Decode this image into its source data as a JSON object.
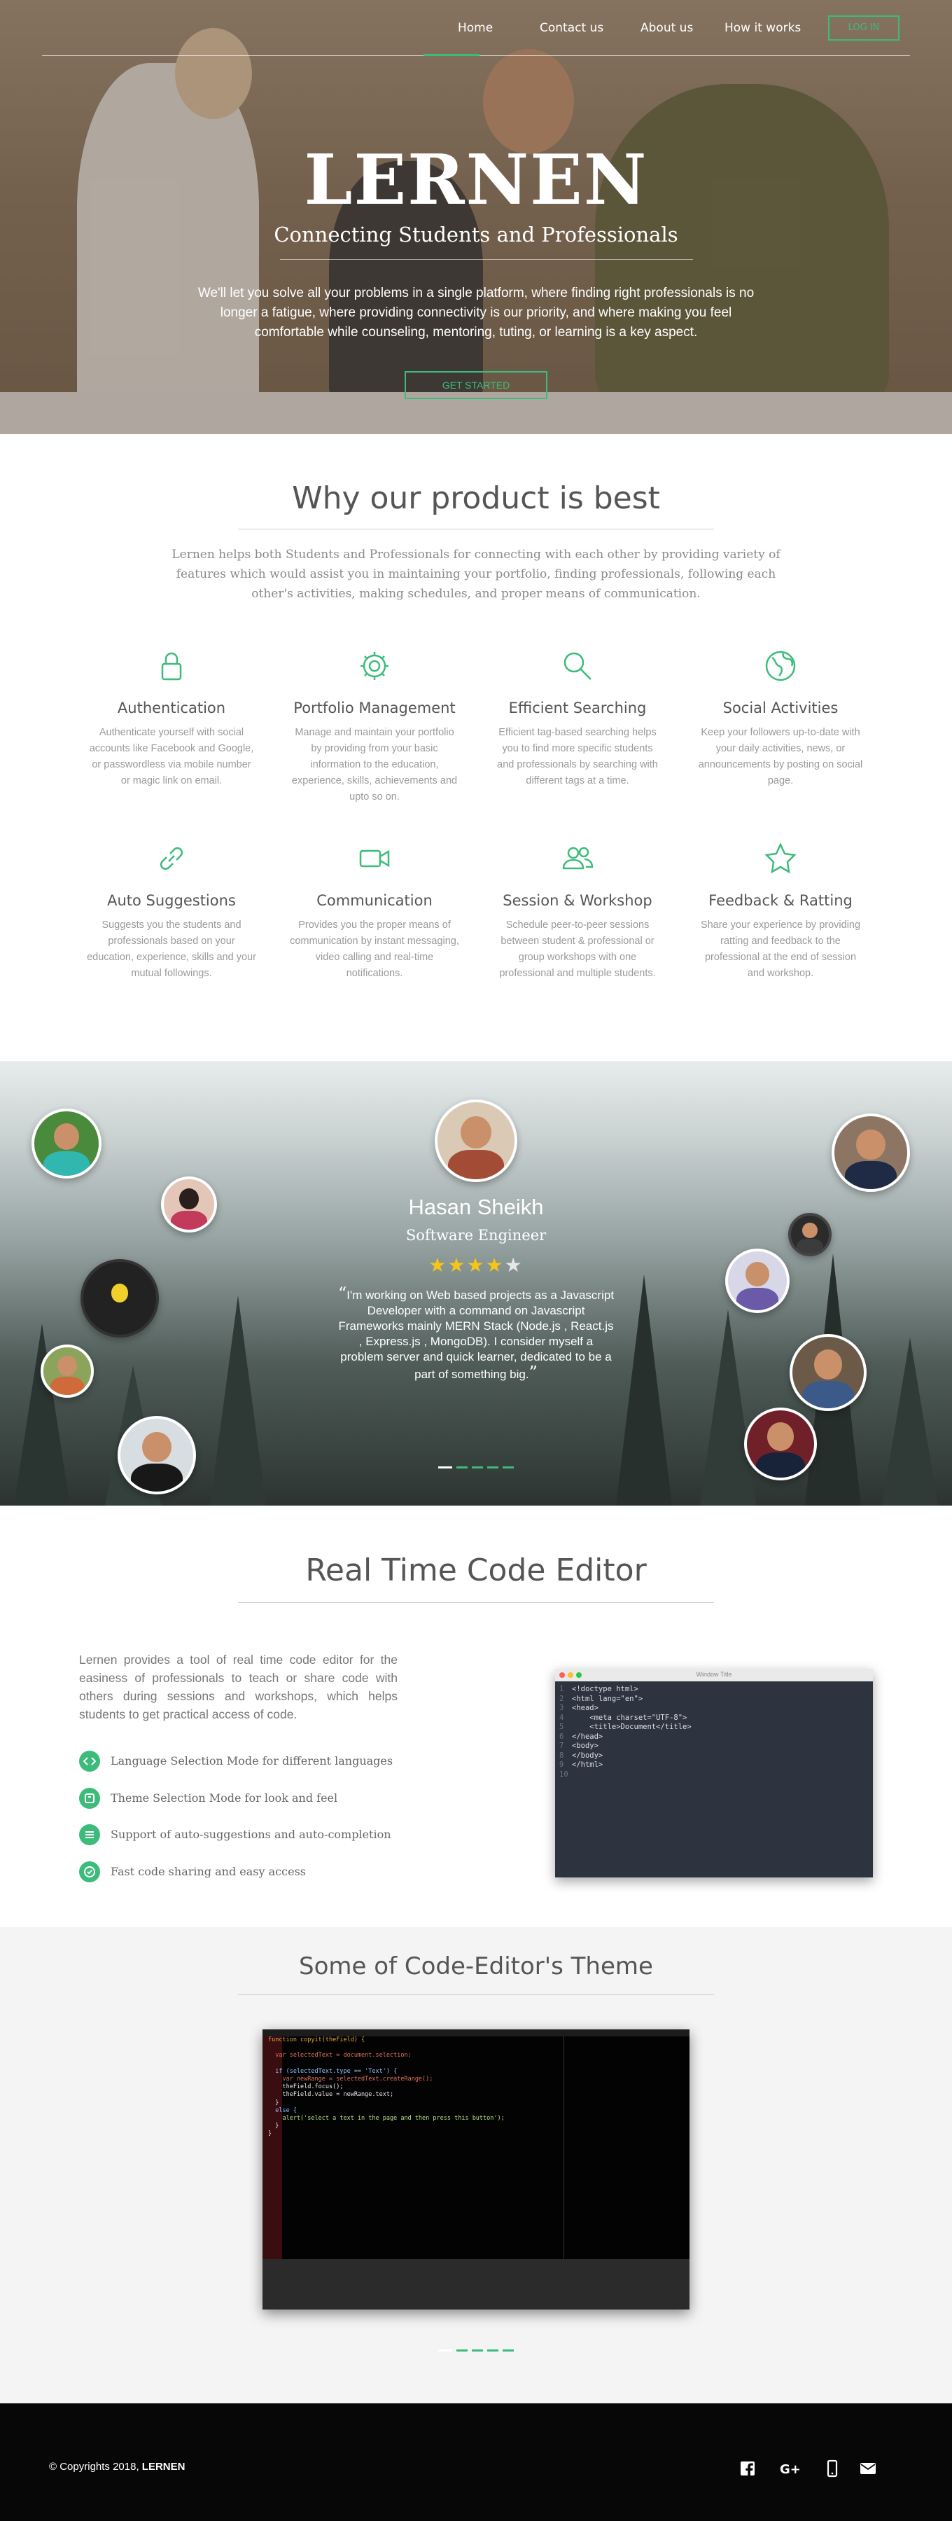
{
  "nav": {
    "items": [
      "Home",
      "Contact us",
      "About us",
      "How it works"
    ],
    "login": "LOG IN"
  },
  "hero": {
    "title": "LERNEN",
    "subtitle": "Connecting Students and Professionals",
    "description": "We'll let you solve all your problems in a single platform, where finding right professionals is no longer a fatigue, where providing connectivity is our priority, and where making you feel comfortable while counseling, mentoring, tuting, or learning is a key aspect.",
    "cta": "GET STARTED"
  },
  "features": {
    "title": "Why our product is best",
    "description": "Lernen helps both Students and Professionals for connecting with each other by providing variety of features which would assist you in maintaining your portfolio, finding professionals, following each other's activities, making schedules, and proper means of communication.",
    "items": [
      {
        "icon": "lock-icon",
        "title": "Authentication",
        "text": "Authenticate yourself with social accounts like Facebook and Google, or passwordless via mobile number or magic link on email."
      },
      {
        "icon": "gear-icon",
        "title": "Portfolio Management",
        "text": "Manage and maintain your portfolio by providing from your basic information to the education, experience, skills, achievements and upto so on."
      },
      {
        "icon": "search-icon",
        "title": "Efficient Searching",
        "text": "Efficient tag-based searching helps you to find more specific students and professionals by searching with different tags at a time."
      },
      {
        "icon": "globe-icon",
        "title": "Social Activities",
        "text": "Keep your followers up-to-date with your daily activities, news, or announcements by posting on social page."
      },
      {
        "icon": "link-icon",
        "title": "Auto Suggestions",
        "text": "Suggests you the students and professionals based on your education, experience, skills and your mutual followings."
      },
      {
        "icon": "video-icon",
        "title": "Communication",
        "text": "Provides you the proper means of communication by instant messaging, video calling and real-time notifications."
      },
      {
        "icon": "users-icon",
        "title": "Session & Workshop",
        "text": "Schedule peer-to-peer sessions between student & professional or group workshops with one professional and multiple students."
      },
      {
        "icon": "star-icon",
        "title": "Feedback & Ratting",
        "text": "Share your experience by providing ratting and feedback to the professional at the end of session and workshop."
      }
    ]
  },
  "testimonial": {
    "name": "Hasan Sheikh",
    "role": "Software Engineer",
    "rating": 4,
    "quote_open": "“",
    "quote": "I'm working on Web based projects as a Javascript Developer with a command on Javascript Frameworks mainly MERN Stack (Node.js , React.js , Express.js , MongoDB). I consider myself a problem server and quick learner, dedicated to be a part of something big.",
    "quote_close": "”"
  },
  "editor": {
    "title": "Real Time Code Editor",
    "intro": "Lernen provides a tool of real time code editor for the easiness of professionals to teach or share code with others during sessions and workshops, which helps students to get practical access of code.",
    "bullets": [
      {
        "icon": "code-icon",
        "text": "Language Selection Mode for different languages"
      },
      {
        "icon": "palette-icon",
        "text": "Theme Selection Mode for look and feel"
      },
      {
        "icon": "list-icon",
        "text": "Support of auto-suggestions and auto-completion"
      },
      {
        "icon": "check-icon",
        "text": "Fast code sharing and easy access"
      }
    ],
    "window_title": "Window Title",
    "code_lines": [
      "<!doctype html>",
      "<html lang=\"en\">",
      "<head>",
      "    <meta charset=\"UTF-8\">",
      "    <title>Document</title>",
      "</head>",
      "<body>",
      "</body>",
      "</html>",
      ""
    ]
  },
  "themes": {
    "title": "Some of Code-Editor's Theme",
    "code_lines": [
      "function copyit(theField) {",
      "",
      "  var selectedText = document.selection;",
      "",
      "  if (selectedText.type == 'Text') {",
      "    var newRange = selectedText.createRange();",
      "    theField.focus();",
      "    theField.value = newRange.text;",
      "  }",
      "  else {",
      "    alert('select a text in the page and then press this button');",
      "  }",
      "}",
      ""
    ]
  },
  "footer": {
    "copyright": "© Copyrights 2018,",
    "brand": "LERNEN",
    "social": [
      "facebook-icon",
      "google-plus-icon",
      "phone-icon",
      "email-icon"
    ]
  },
  "colors": {
    "accent": "#3dbb7b",
    "star": "#f5c518",
    "footer": "#070707"
  }
}
